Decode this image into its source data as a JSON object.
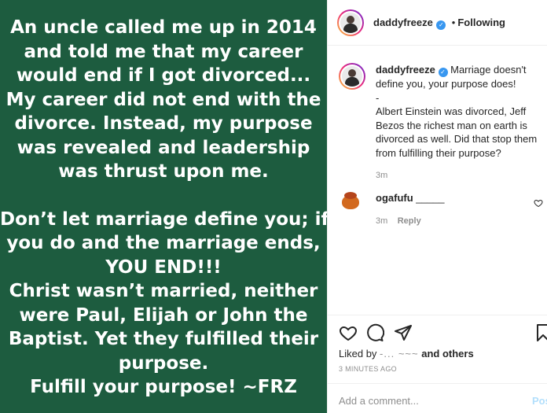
{
  "image_text": {
    "lines_a": [
      "An uncle called me up in 2014",
      "and told me that my career",
      "would end if I got divorced...",
      "My career did not end with the",
      "divorce. Instead, my purpose",
      "was revealed and leadership",
      "was thrust upon me."
    ],
    "lines_b": [
      "Don’t let marriage define you; if",
      "you do and the marriage ends,",
      "YOU END!!!",
      "Christ wasn’t married, neither",
      "were Paul, Elijah or John the",
      "Baptist. Yet they fulfilled their",
      "purpose.",
      "Fulfill your purpose! ~FRZ"
    ]
  },
  "header": {
    "username": "daddyfreeze",
    "separator": "•",
    "follow_status": "Following"
  },
  "caption": {
    "username": "daddyfreeze",
    "text_1": "Marriage doesn't define you, your purpose does!",
    "text_2": "-",
    "text_3": "Albert Einstein was divorced, Jeff Bezos the richest man on earth is divorced as well. Did that stop them from fulfilling their purpose?",
    "time": "3m"
  },
  "comment": {
    "username": "ogafufu",
    "text": "_____",
    "time": "3m",
    "reply_label": "Reply"
  },
  "likes": {
    "prefix": "Liked by",
    "obscured": "-...    ~~~",
    "suffix": "and others"
  },
  "posted_ago": "3 MINUTES AGO",
  "add_comment": {
    "placeholder": "Add a comment...",
    "post_label": "Post"
  },
  "colors": {
    "image_bg": "#1d5c3f",
    "verified": "#3897f0"
  }
}
